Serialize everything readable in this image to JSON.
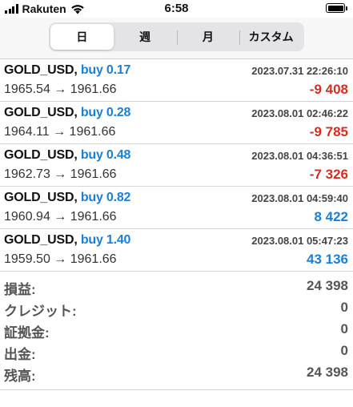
{
  "status_bar": {
    "carrier": "Rakuten",
    "time": "6:58"
  },
  "tabs": [
    {
      "label": "日",
      "active": true
    },
    {
      "label": "週",
      "active": false
    },
    {
      "label": "月",
      "active": false
    },
    {
      "label": "カスタム",
      "active": false
    }
  ],
  "trades": [
    {
      "symbol": "GOLD_USD",
      "separator": ",",
      "side": "buy 0.17",
      "time": "2023.07.31 22:26:10",
      "prices": "1965.54 → 1961.66",
      "profit": "-9 408",
      "sign": "neg"
    },
    {
      "symbol": "GOLD_USD",
      "separator": ",",
      "side": "buy 0.28",
      "time": "2023.08.01 02:46:22",
      "prices": "1964.11 → 1961.66",
      "profit": "-9 785",
      "sign": "neg"
    },
    {
      "symbol": "GOLD_USD",
      "separator": ",",
      "side": "buy 0.48",
      "time": "2023.08.01 04:36:51",
      "prices": "1962.73 → 1961.66",
      "profit": "-7 326",
      "sign": "neg"
    },
    {
      "symbol": "GOLD_USD",
      "separator": ",",
      "side": "buy 0.82",
      "time": "2023.08.01 04:59:40",
      "prices": "1960.94 → 1961.66",
      "profit": "8 422",
      "sign": "pos"
    },
    {
      "symbol": "GOLD_USD",
      "separator": ",",
      "side": "buy 1.40",
      "time": "2023.08.01 05:47:23",
      "prices": "1959.50 → 1961.66",
      "profit": "43 136",
      "sign": "pos"
    }
  ],
  "summary": [
    {
      "label": "損益:",
      "value": "24 398"
    },
    {
      "label": "クレジット:",
      "value": "0"
    },
    {
      "label": "証拠金:",
      "value": "0"
    },
    {
      "label": "出金:",
      "value": "0"
    },
    {
      "label": "残高:",
      "value": "24 398"
    }
  ],
  "colors": {
    "negative": "#d42d22",
    "positive": "#1a7fd6",
    "side": "#1a7fd6"
  }
}
